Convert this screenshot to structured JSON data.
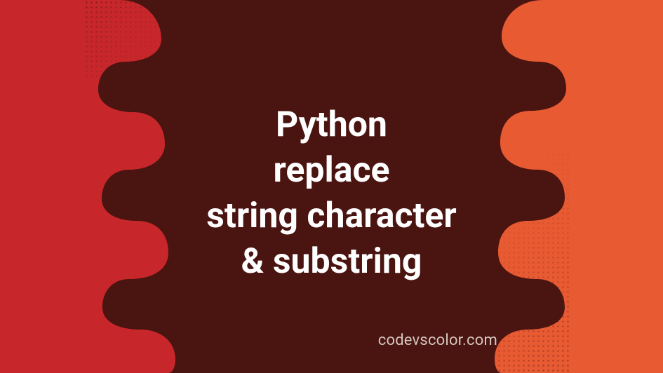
{
  "colors": {
    "background": "#4a1410",
    "blob_left": "#c7272b",
    "blob_right": "#e85a32",
    "text": "#ffffff",
    "watermark": "#d6c7c3"
  },
  "title_lines": {
    "line1": "Python",
    "line2": "replace",
    "line3": "string character",
    "line4": "& substring"
  },
  "watermark": "codevscolor.com"
}
